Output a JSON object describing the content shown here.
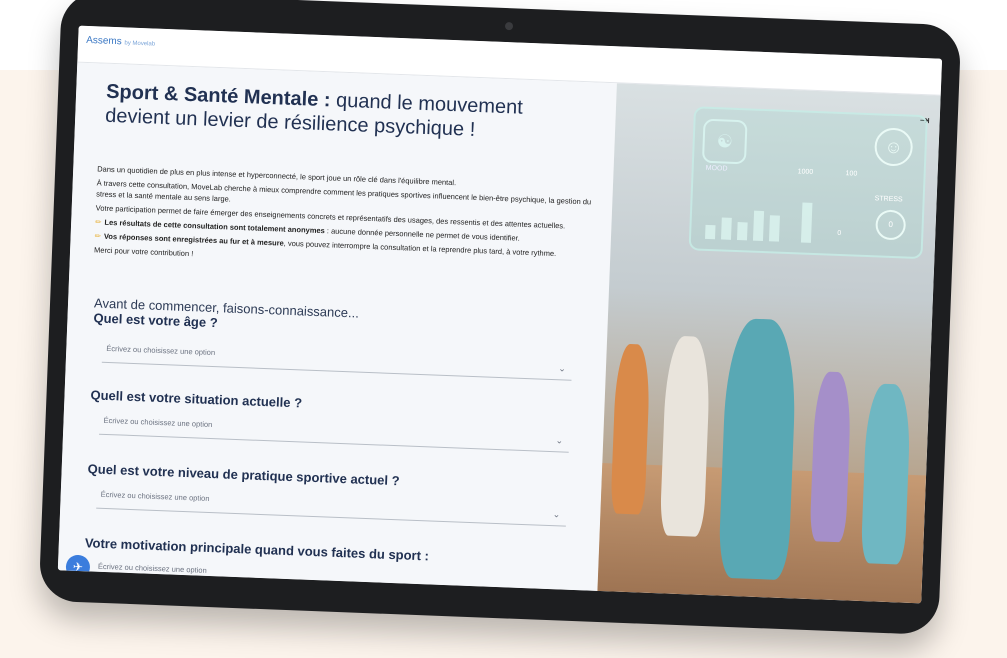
{
  "app": {
    "logo": "Assems",
    "logo_sub": "by Movelab"
  },
  "header": {
    "logout_icon": "logout-icon"
  },
  "page": {
    "title_bold": "Sport & Santé Mentale :",
    "title_rest": " quand le mouvement devient un levier de résilience psychique !",
    "intro": [
      "Dans un quotidien de plus en plus intense et hyperconnecté, le sport joue un rôle clé dans l'équilibre mental.",
      "À travers cette consultation, MoveLab cherche à mieux comprendre comment les pratiques sportives influencent le bien-être psychique, la gestion du stress et la santé mentale au sens large.",
      "Votre participation permet de faire émerger des enseignements concrets et représentatifs des usages, des ressentis et des attentes actuelles."
    ],
    "bullets": [
      {
        "bold": "Les résultats de cette consultation sont totalement anonymes",
        "rest": " : aucune donnée personnelle ne permet de vous identifier."
      },
      {
        "bold": "Vos réponses sont enregistrées au fur et à mesure",
        "rest": ", vous pouvez interrompre la consultation et la reprendre plus tard, à votre rythme."
      }
    ],
    "thanks": "Merci pour votre contribution !"
  },
  "questions": [
    {
      "pre": "Avant de commencer, faisons-connaissance...",
      "title": "Quel est votre âge ?",
      "placeholder": "Écrivez ou choisissez une option"
    },
    {
      "pre": "",
      "title": "Quell est votre situation actuelle ?",
      "placeholder": "Écrivez ou choisissez une option"
    },
    {
      "pre": "",
      "title": "Quel est votre niveau de pratique sportive actuel ?",
      "placeholder": "Écrivez ou choisissez une option"
    },
    {
      "pre": "",
      "title": "Votre motivation principale quand vous faites du sport :",
      "placeholder": "Écrivez ou choisissez une option"
    }
  ],
  "dashboard": {
    "mood": "MOOD",
    "n1": "1000",
    "n2": "100",
    "stress": "STRESS",
    "gauge": "0",
    "zero": "0"
  },
  "accent": "#3b7ddd"
}
